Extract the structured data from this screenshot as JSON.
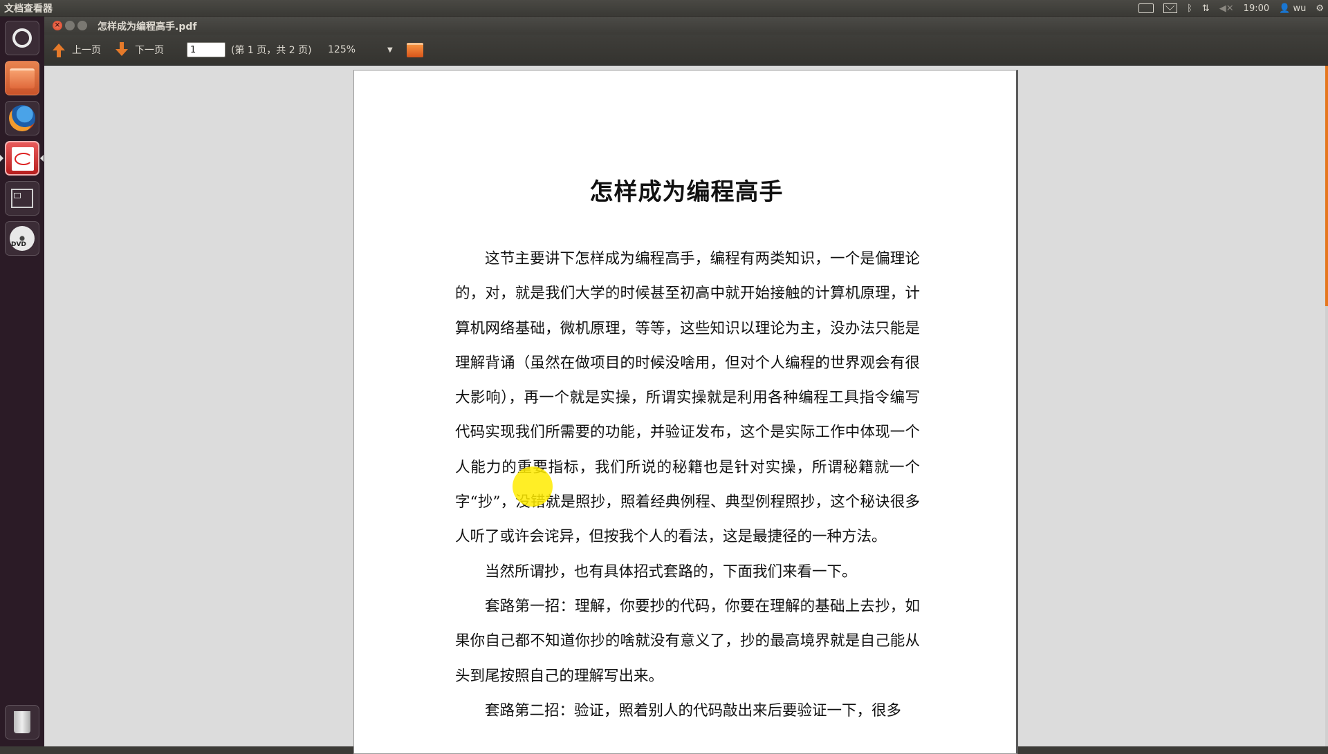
{
  "system": {
    "app_name": "文档查看器",
    "clock": "19:00",
    "user": "wu"
  },
  "window": {
    "title": "怎样成为编程高手.pdf"
  },
  "toolbar": {
    "prev_label": "上一页",
    "next_label": "下一页",
    "page_value": "1",
    "page_info": "(第 1 页，共 2 页)",
    "zoom_value": "125%"
  },
  "document": {
    "title": "怎样成为编程高手",
    "paragraphs": [
      "这节主要讲下怎样成为编程高手，编程有两类知识，一个是偏理论的，对，就是我们大学的时候甚至初高中就开始接触的计算机原理，计算机网络基础，微机原理，等等，这些知识以理论为主，没办法只能是理解背诵（虽然在做项目的时候没啥用，但对个人编程的世界观会有很大影响），再一个就是实操，所谓实操就是利用各种编程工具指令编写代码实现我们所需要的功能，并验证发布，这个是实际工作中体现一个人能力的重要指标，我们所说的秘籍也是针对实操，所谓秘籍就一个字“抄”，没错就是照抄，照着经典例程、典型例程照抄，这个秘诀很多人听了或许会诧异，但按我个人的看法，这是最捷径的一种方法。",
      "当然所谓抄，也有具体招式套路的，下面我们来看一下。",
      "套路第一招：理解，你要抄的代码，你要在理解的基础上去抄，如果你自己都不知道你抄的啥就没有意义了，抄的最高境界就是自己能从头到尾按照自己的理解写出来。",
      "套路第二招：验证，照着别人的代码敲出来后要验证一下，很多"
    ]
  },
  "colors": {
    "accent": "#e5771e",
    "panel": "#3c3b37",
    "launcher": "#2b1b26"
  },
  "icons": [
    "dash-icon",
    "files-icon",
    "firefox-icon",
    "document-viewer-icon",
    "workspace-switcher-icon",
    "dvd-icon",
    "trash-icon",
    "keyboard-icon",
    "mail-icon",
    "bluetooth-icon",
    "network-icon",
    "volume-icon",
    "user-icon",
    "gear-icon"
  ]
}
